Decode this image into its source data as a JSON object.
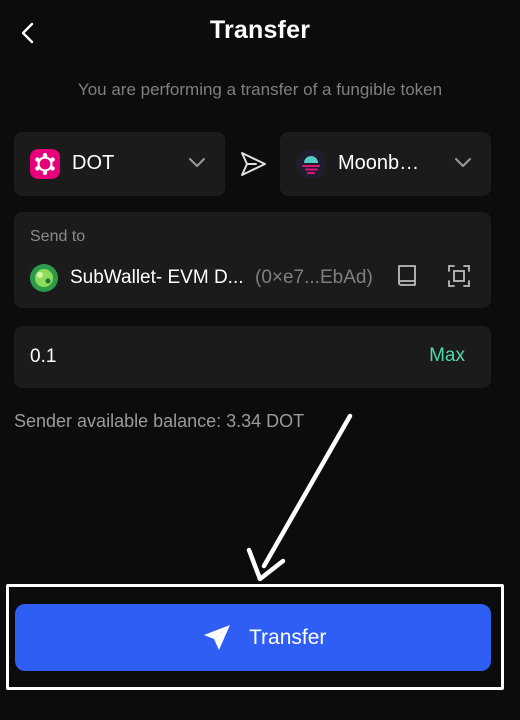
{
  "header": {
    "title": "Transfer",
    "back_icon": "chevron-left-icon"
  },
  "subtitle": "You are performing a transfer of a fungible token",
  "token_selector": {
    "label": "DOT",
    "icon": "polkadot-icon",
    "icon_color": "#e6007a"
  },
  "transfer_arrow_icon": "send-arrow-icon",
  "chain_selector": {
    "label": "Moonbeam",
    "icon": "moonbeam-icon",
    "icon_color": "#53cbc8"
  },
  "send_to": {
    "label": "Send to",
    "account_name": "SubWallet- EVM D...",
    "account_address": "(0×e7...EbAd)",
    "avatar_icon": "account-avatar-icon",
    "book_icon": "address-book-icon",
    "scan_icon": "scan-qr-icon"
  },
  "amount": {
    "value": "0.1",
    "max_label": "Max",
    "max_color": "#4cd9ac"
  },
  "balance_text": "Sender available balance: 3.34 DOT",
  "submit": {
    "label": "Transfer",
    "icon": "paper-plane-icon",
    "color": "#2f5ef5"
  }
}
